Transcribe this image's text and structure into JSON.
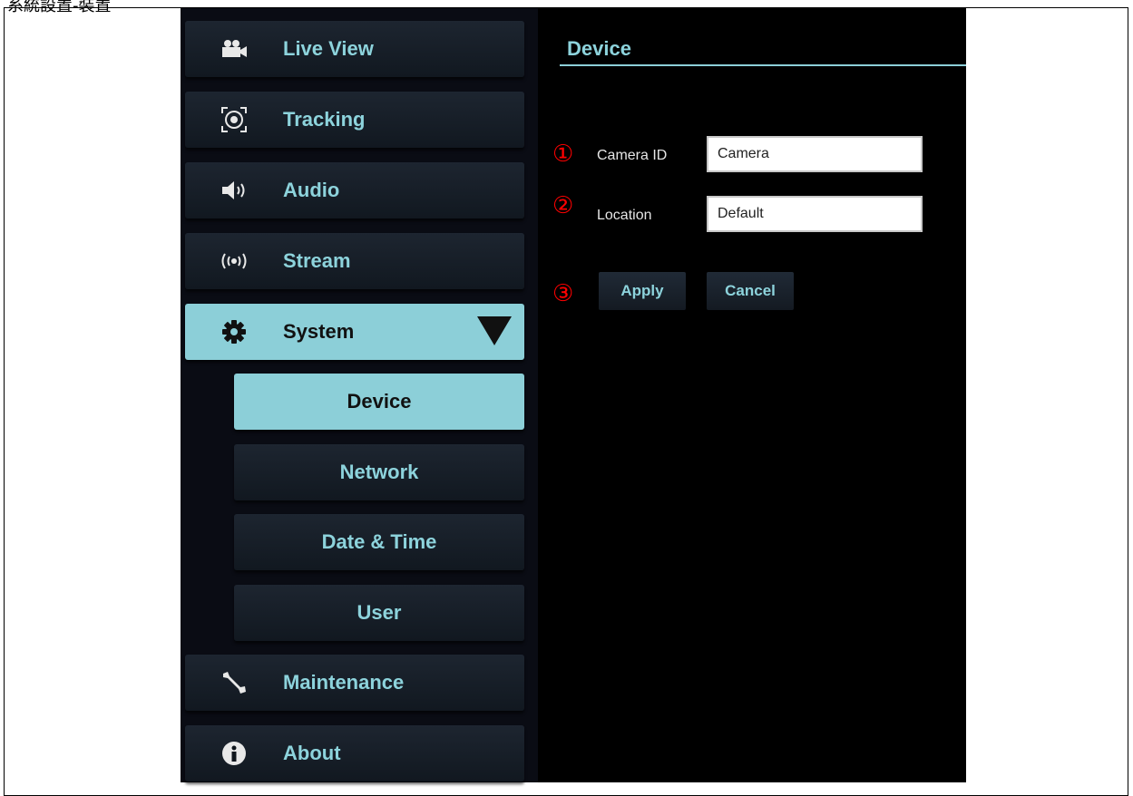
{
  "caption": "系統設置-裝置",
  "sidebar": {
    "items": [
      {
        "label": "Live View",
        "icon": "video-camera-icon"
      },
      {
        "label": "Tracking",
        "icon": "tracking-target-icon"
      },
      {
        "label": "Audio",
        "icon": "speaker-icon"
      },
      {
        "label": "Stream",
        "icon": "broadcast-icon"
      },
      {
        "label": "System",
        "icon": "gear-icon",
        "expanded": true
      },
      {
        "label": "Maintenance",
        "icon": "wrench-icon"
      },
      {
        "label": "About",
        "icon": "info-icon"
      }
    ],
    "sub_items": [
      {
        "label": "Device",
        "active": true
      },
      {
        "label": "Network"
      },
      {
        "label": "Date & Time"
      },
      {
        "label": "User"
      }
    ]
  },
  "content": {
    "title": "Device",
    "fields": [
      {
        "marker": "①",
        "label": "Camera ID",
        "value": "Camera"
      },
      {
        "marker": "②",
        "label": "Location",
        "value": "Default"
      }
    ],
    "buttons_marker": "③",
    "apply_label": "Apply",
    "cancel_label": "Cancel"
  },
  "colors": {
    "accent": "#8ccfd8",
    "background": "#000000",
    "marker": "#ff0000"
  }
}
